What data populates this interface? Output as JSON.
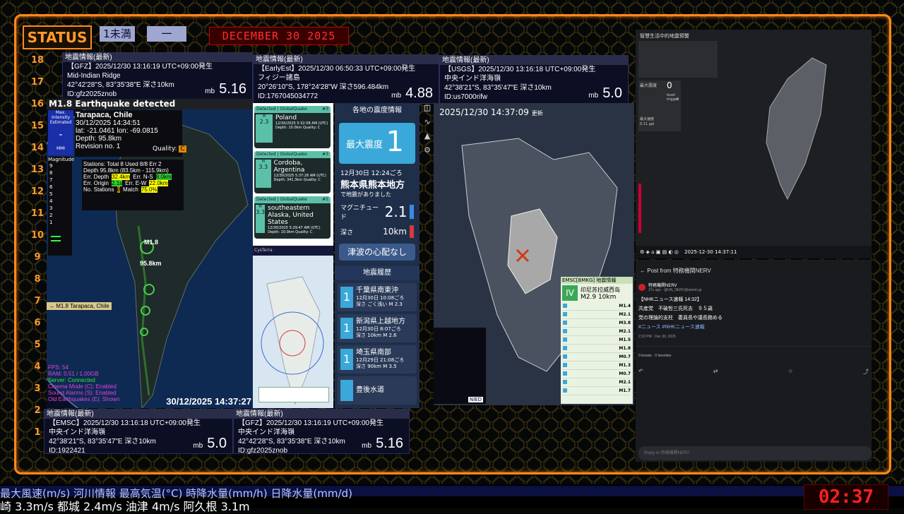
{
  "status_label": "STATUS",
  "top_tags": [
    "1未満",
    "一"
  ],
  "date_banner": "DECEMBER 30 2025",
  "scale_labels": [
    "18",
    "17",
    "16",
    "15",
    "14",
    "13",
    "12",
    "11",
    "10",
    "9",
    "8",
    "7",
    "6",
    "5",
    "4",
    "3",
    "2",
    "1"
  ],
  "panels": [
    {
      "header": "地震情報(最新)",
      "source": "【GFZ】2025/12/30 13:16:19 UTC+09:00発生",
      "region": "Mid-Indian Ridge",
      "coords": "42°42'28\"S, 83°35'38\"E 深さ10km",
      "id": "ID:gfz2025znob",
      "mb": "mb",
      "mag": "5.16"
    },
    {
      "header": "地震情報(最新)",
      "source": "【EarlyEst】2025/12/30 06:50:33 UTC+09:00発生",
      "region": "フィジー諸島",
      "coords": "20°26'10\"S, 178°24'28\"W 深さ596.484km",
      "id": "ID:1767045034772",
      "mb": "mb",
      "mag": "4.88"
    },
    {
      "header": "地震情報(最新)",
      "source": "【USGS】2025/12/30 13:16:18 UTC+09:00発生",
      "region": "中央インド洋海嶺",
      "coords": "42°38'21\"S, 83°35'47\"E 深さ10km",
      "id": "ID:us7000rifw",
      "mb": "mb",
      "mag": "5.0"
    },
    {
      "header": "地震情報(最新)",
      "source": "【EMSC】2025/12/30 13:16:18 UTC+09:00発生",
      "region": "中央インド洋海嶺",
      "coords": "42°38'21\"S, 83°35'47\"E 深さ10km",
      "id": "ID:1922421",
      "mb": "mb",
      "mag": "5.0"
    },
    {
      "header": "地震情報(最新)",
      "source": "【GFZ】2025/12/30 13:16:19 UTC+09:00発生",
      "region": "中央インド洋海嶺",
      "coords": "42°42'28\"S, 83°35'38\"E 深さ10km",
      "id": "ID:gfz2025znob",
      "mb": "mb",
      "mag": "5.16"
    }
  ],
  "globe": {
    "title": "M1.8 Earthquake detected",
    "intensity_label": "Max. Intensity Estimated",
    "intensity_value": "-",
    "intensity_unit": "MMI",
    "place": "Tarapaca, Chile",
    "time": "30/12/2025 14:34:51",
    "latlon": "lat: -21.0461 lon: -69.0815",
    "depth": "Depth: 95.8km",
    "revision": "Revision no. 1",
    "quality": "Quality:",
    "quality_val": "C",
    "magnitude_label": "Magnitude",
    "stations": "Stations: Total 8 Used 8/8 Err 2",
    "depth_range": "Depth 95.8km (83.5km - 115.9km)",
    "err_depth_label": "Err. Depth",
    "err_depth": "32.4km",
    "err_ns_label": "Err. N-S",
    "err_ns": "8.0km",
    "err_origin_label": "Err. Origin",
    "err_origin": "2.1s",
    "err_ew_label": "Err. E-W",
    "err_ew": "22.0km",
    "no_stations_label": "No. Stations",
    "no_stations": "8",
    "match_label": "Match",
    "match": "75.0%",
    "marker_mag": "M1.8",
    "marker_depth": "95.8km",
    "side_tag": "→ M1.8 Tarapaca, Chile",
    "stats": [
      "FPS: 54",
      "RAM: 0.51 / 1.00GB",
      "Server: Connected",
      "Cinema Mode (C): Enabled",
      "Sound Alarms (S): Enabled",
      "Old Earthquakes (E): Shown"
    ],
    "timestamp": "30/12/2025 14:37:27",
    "scale_ticks": [
      "9",
      "8",
      "7",
      "6",
      "5",
      "4",
      "3",
      "2",
      "1"
    ]
  },
  "globalquake": {
    "cards": [
      {
        "header": "Detected | GlobalQuake",
        "num": "#3",
        "mag_label": "M",
        "mag": "2.3",
        "place": "Poland",
        "l1": "12/30/2025 5:32:58 AM (UTC)",
        "l2": "Depth: 10.0km  Quality: C"
      },
      {
        "header": "Detected | GlobalQuake",
        "num": "#3",
        "mag_label": "M",
        "mag": "3.3",
        "place": "Cordoba, Argentina",
        "l1": "12/30/2025 5:37:28 AM (UTC)",
        "l2": "Depth: 341.3km  Quality: C"
      },
      {
        "header": "Detected | GlobalQuake",
        "num": "#5",
        "mag_label": "M",
        "mag": "3.3",
        "place": "southeastern Alaska, United States",
        "l1": "12/30/2025 5:29:47 AM (UTC)",
        "l2": "Depth: 10.0km  Quality: C"
      }
    ],
    "footer_brand": "CysTerra",
    "map_card_place": "Cordoba, Argentina",
    "map_card_mag": "3.3"
  },
  "jp_info": {
    "title": "各地の震度情報",
    "max_label": "最大震度",
    "max_value": "1",
    "datetime": "12月30日 12:24ごろ",
    "region": "熊本県熊本地方",
    "note": "で地震がありました",
    "mag_label": "マグニチュード",
    "mag_value": "2.1",
    "depth_label": "深さ",
    "depth_value": "10km",
    "tsunami": "津波の心配なし",
    "history_title": "地震履歴",
    "history": [
      {
        "int": "1",
        "place": "千葉県南東沖",
        "time": "12月30日 10:08ごろ",
        "depth": "深さ ごく浅い",
        "mag": "M 2.3"
      },
      {
        "int": "1",
        "place": "新潟県上越地方",
        "time": "12月30日 8:07ごろ",
        "depth": "深さ 10km",
        "mag": "M 2.6"
      },
      {
        "int": "1",
        "place": "埼玉県南部",
        "time": "12月29日 21:08ごろ",
        "depth": "深さ 90km",
        "mag": "M 3.5"
      },
      {
        "int": "",
        "place": "豊後水道",
        "time": "",
        "depth": "",
        "mag": ""
      }
    ]
  },
  "kyushu": {
    "timestamp": "2025/12/30 14:37:09",
    "update_label": "更新",
    "bmkg_header": "EMSC[BMKG] 地震情報",
    "bmkg_int": "IV",
    "bmkg_place": "印尼苏拉威西岛",
    "bmkg_mag": "M2.9",
    "bmkg_depth": "10km",
    "bmkg_list": [
      "M1.4",
      "M2.1",
      "M3.8",
      "M2.1",
      "M1.5",
      "M1.8",
      "M0.7",
      "M1.3",
      "M0.7",
      "M2.1",
      "M1.7"
    ],
    "nied_label": "NIED"
  },
  "taiwan": {
    "title": "智慧生活中的地震預警",
    "max_label": "最大震度",
    "max_value": "0",
    "level_label": "level",
    "trigger_label": "trigger",
    "trigger_val": "0",
    "speed_label": "最大速度",
    "speed_val": "0.11 gal",
    "timestamp": "2025-12-30 14:37:11"
  },
  "social": {
    "back_label": "Post from 特務機関NERV",
    "account": "特務機関NERV",
    "handle": "37s ago · @UN_NERV@amem.jp",
    "lines": [
      "【NHKニュース速報 14:32】",
      "共産党　不破哲三氏死去　９５歳",
      "党の理論的支柱　委員長や議長務める",
      "#ニュース #NHKニュース速報"
    ],
    "meta": "2:32 PM · Dec 30, 2025",
    "stats": "0 boosts · 0 favorites",
    "reply_placeholder": "Reply to 特務機関NERV"
  },
  "ticker": {
    "line1": "最大風速(m/s)  河川情報  最高気温(°C)  時降水量(mm/h)  日降水量(mm/d)",
    "line2": "崎 3.3m/s  都城 2.4m/s  油津 4m/s  阿久根 3.1m"
  },
  "clock": "02:37"
}
